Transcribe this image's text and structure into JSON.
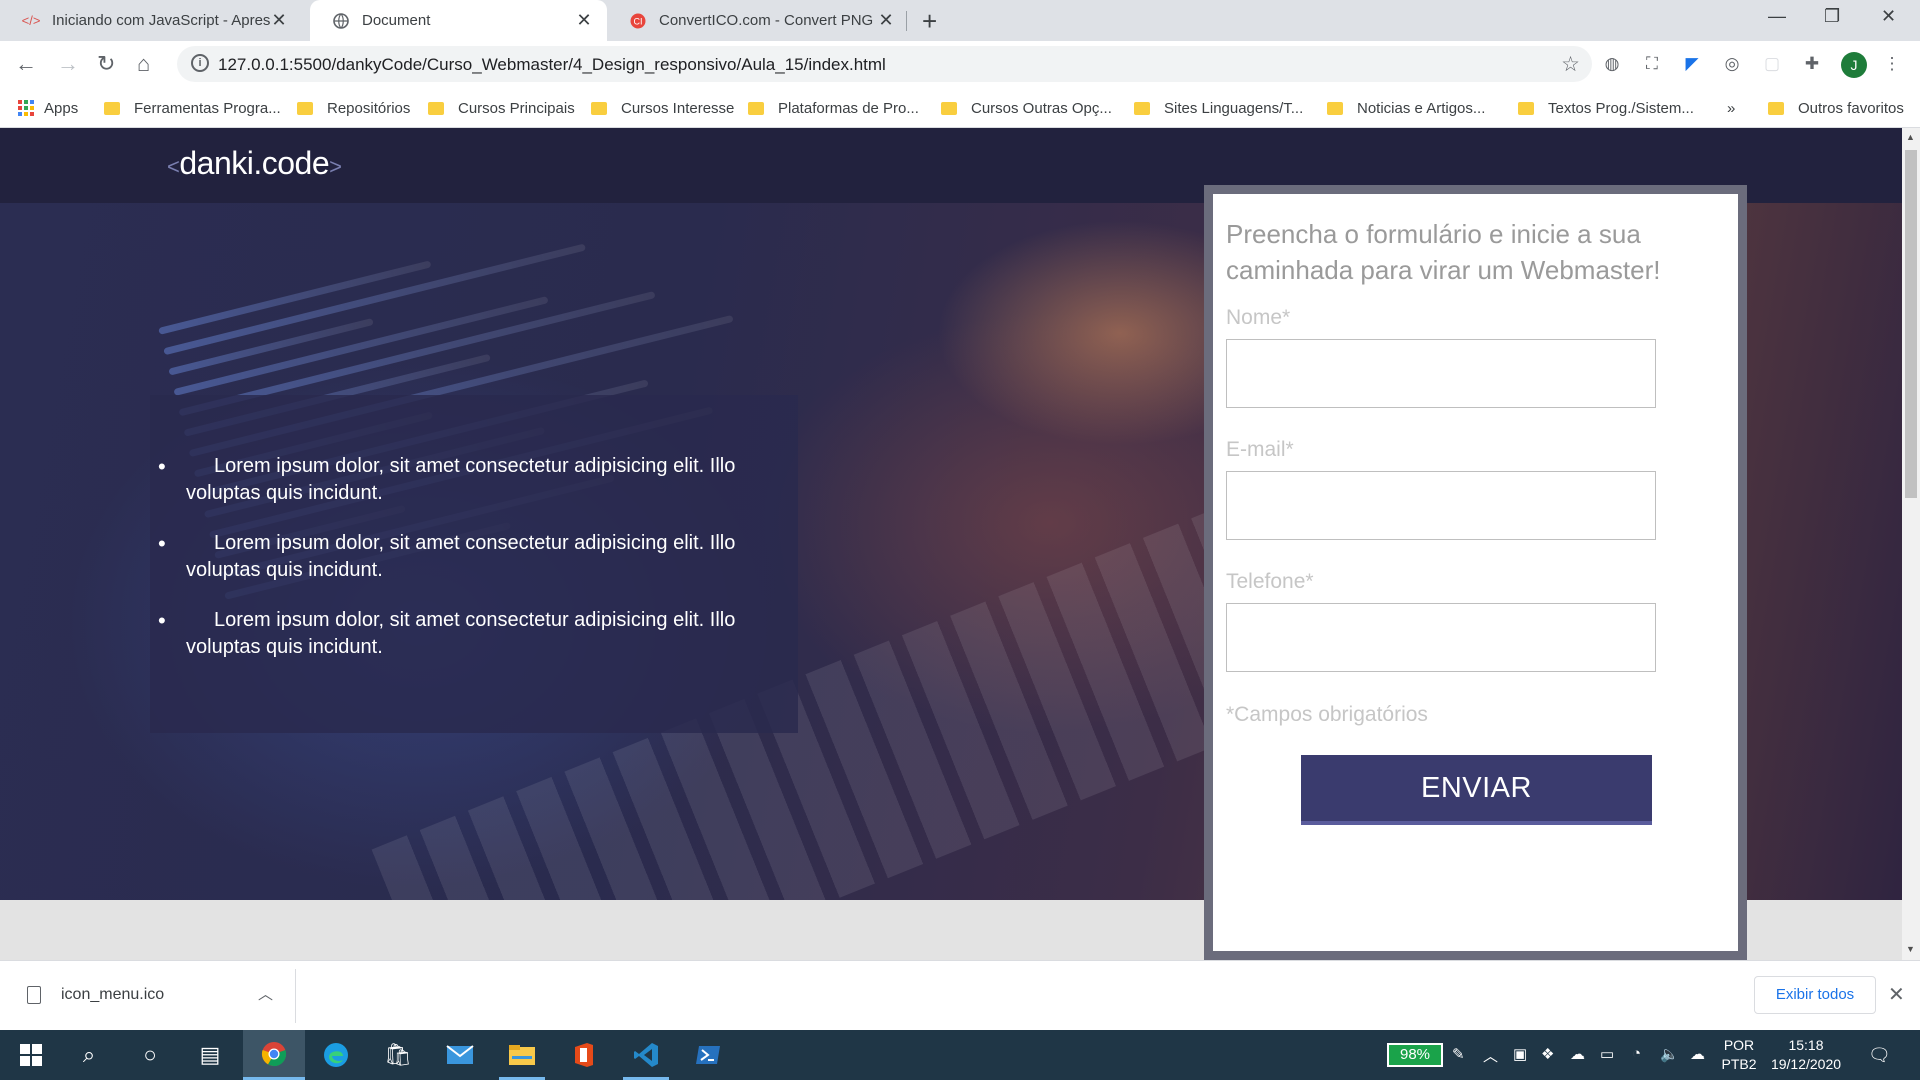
{
  "browser": {
    "tabs": [
      {
        "title": "Iniciando com JavaScript - Apres",
        "favicon": "code-icon"
      },
      {
        "title": "Document",
        "favicon": "globe-icon"
      },
      {
        "title": "ConvertICO.com - Convert PNG t",
        "favicon": "converticon-icon"
      }
    ],
    "url": "127.0.0.1:5500/dankyCode/Curso_Webmaster/4_Design_responsivo/Aula_15/index.html",
    "avatar_letter": "J",
    "bookmarks": [
      "Apps",
      "Ferramentas Progra...",
      "Repositórios",
      "Cursos Principais",
      "Cursos Interesse",
      "Plataformas de Pro...",
      "Cursos Outras Opç...",
      "Sites Linguagens/T...",
      "Noticias e Artigos...",
      "Textos Prog./Sistem..."
    ],
    "bookmarks_overflow": "»",
    "other_bookmarks": "Outros favoritos"
  },
  "page": {
    "logo": {
      "left": "<",
      "text": "danki.code",
      "right": ">"
    },
    "bullets": [
      "Lorem ipsum dolor, sit amet consectetur adipisicing elit. Illo voluptas quis incidunt.",
      "Lorem ipsum dolor, sit amet consectetur adipisicing elit. Illo voluptas quis incidunt.",
      "Lorem ipsum dolor, sit amet consectetur adipisicing elit. Illo voluptas quis incidunt."
    ],
    "form": {
      "heading": "Preencha o formulário e inicie a sua caminhada para virar um Webmaster!",
      "name_label": "Nome*",
      "email_label": "E-mail*",
      "phone_label": "Telefone*",
      "required_note": "*Campos obrigatórios",
      "submit": "ENVIAR"
    },
    "colors": {
      "header": "#22223e",
      "button": "#3a3b6e",
      "form_border": "#6b6c7c"
    }
  },
  "downloads": {
    "file": "icon_menu.ico",
    "show_all": "Exibir todos"
  },
  "taskbar": {
    "battery": "98%",
    "lang1": "POR",
    "lang2": "PTB2",
    "time": "15:18",
    "date": "19/12/2020"
  }
}
